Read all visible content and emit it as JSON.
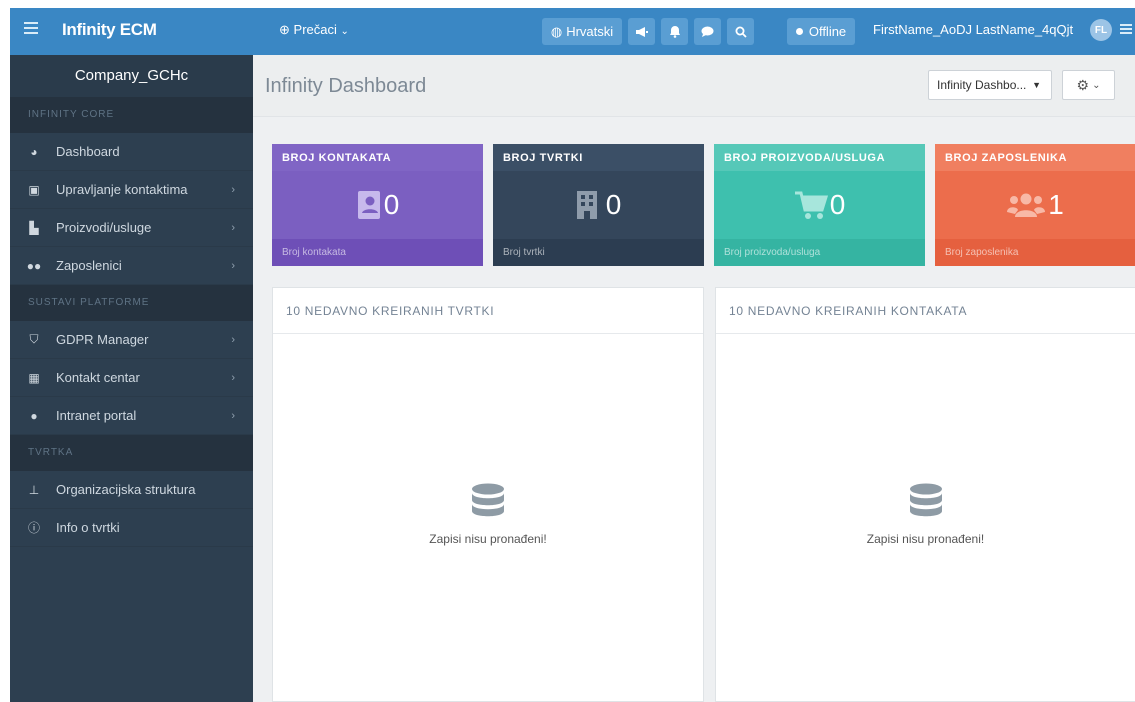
{
  "topbar": {
    "brand": "Infinity ECM",
    "shortcuts": "Prečaci",
    "language": "Hrvatski",
    "status": "Offline",
    "user": "FirstName_AoDJ LastName_4qQjt",
    "avatar_initials": "FL"
  },
  "sidebar": {
    "company": "Company_GCHc",
    "sections": [
      {
        "title": "INFINITY CORE",
        "items": [
          {
            "label": "Dashboard",
            "icon": "dashboard-icon"
          },
          {
            "label": "Upravljanje kontaktima",
            "icon": "contact-card-icon"
          },
          {
            "label": "Proizvodi/usluge",
            "icon": "boxes-icon"
          },
          {
            "label": "Zaposlenici",
            "icon": "users-icon"
          }
        ]
      },
      {
        "title": "SUSTAVI PLATFORME",
        "items": [
          {
            "label": "GDPR Manager",
            "icon": "shield-icon"
          },
          {
            "label": "Kontakt centar",
            "icon": "building-icon"
          },
          {
            "label": "Intranet portal",
            "icon": "comment-icon"
          }
        ]
      },
      {
        "title": "TVRTKA",
        "items": [
          {
            "label": "Organizacijska struktura",
            "icon": "sitemap-icon"
          },
          {
            "label": "Info o tvrtki",
            "icon": "info-icon"
          }
        ]
      }
    ]
  },
  "header": {
    "title": "Infinity Dashboard",
    "select_value": "Infinity Dashbo..."
  },
  "cards": [
    {
      "title": "BROJ KONTAKATA",
      "value": "0",
      "footer": "Broj kontakata",
      "color": "#8065c5",
      "body_color": "#7b5fc1",
      "foot_color": "#6e4fb7",
      "icon": "address-book-icon"
    },
    {
      "title": "BROJ TVRTKI",
      "value": "0",
      "footer": "Broj tvrtki",
      "color": "#3b4f66",
      "body_color": "#34465b",
      "foot_color": "#2c3d51",
      "icon": "building-icon"
    },
    {
      "title": "BROJ PROIZVODA/USLUGA",
      "value": "0",
      "footer": "Broj proizvoda/usluga",
      "color": "#56c8b8",
      "body_color": "#3ec0ae",
      "foot_color": "#35b4a2",
      "icon": "shopping-cart-icon"
    },
    {
      "title": "BROJ ZAPOSLENIKA",
      "value": "1",
      "footer": "Broj zaposlenika",
      "color": "#f07f60",
      "body_color": "#ec6d4c",
      "foot_color": "#e5603f",
      "icon": "users-icon"
    }
  ],
  "panels": [
    {
      "title": "10 NEDAVNO KREIRANIH TVRTKI",
      "empty": "Zapisi nisu pronađeni!"
    },
    {
      "title": "10 NEDAVNO KREIRANIH KONTAKATA",
      "empty": "Zapisi nisu pronađeni!"
    }
  ]
}
